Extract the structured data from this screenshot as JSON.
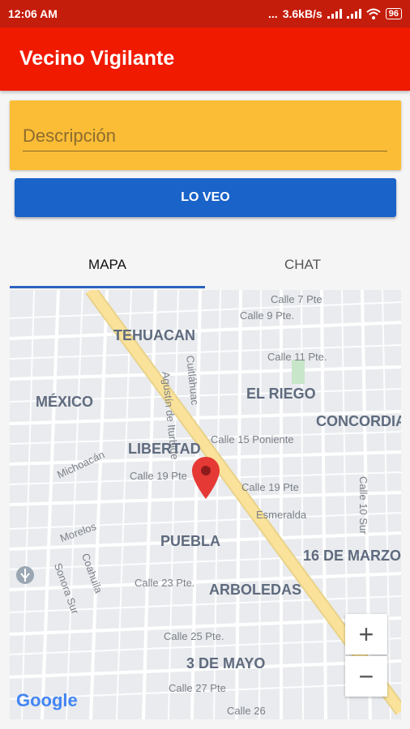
{
  "status_bar": {
    "time": "12:06 AM",
    "dots": "...",
    "speed": "3.6kB/s",
    "battery": "96"
  },
  "app_bar": {
    "title": "Vecino Vigilante"
  },
  "description": {
    "placeholder": "Descripción",
    "value": ""
  },
  "action_button": {
    "label": "LO VEO"
  },
  "tabs": [
    {
      "label": "MAPA",
      "selected": true
    },
    {
      "label": "CHAT",
      "selected": false
    }
  ],
  "map": {
    "neighborhoods": [
      "TEHUACAN",
      "MÉXICO",
      "EL RIEGO",
      "CONCORDIA",
      "LIBERTAD",
      "PUEBLA",
      "16 DE MARZO",
      "ARBOLEDAS",
      "3 DE MAYO"
    ],
    "streets": [
      "Calle 7 Pte",
      "Calle 9 Pte.",
      "Calle 11 Pte.",
      "Agustín de Iturbide",
      "Cuitláhuac",
      "Calle 15 Poniente",
      "Calle 19 Pte",
      "Calle 19 Pte",
      "Esmeralda",
      "Calle 10 Sur",
      "Michoacán",
      "Morelos",
      "Sonora Sur",
      "Coahuila",
      "Calle 23 Pte.",
      "Calle 25 Pte.",
      "Calle 27 Pte",
      "Calle 26"
    ],
    "zoom_in": "+",
    "zoom_out": "−",
    "google_logo": "Google",
    "colors": {
      "highway": "#fbe29a",
      "pin": "#e53935",
      "park": "#c8e6c9",
      "neighborhood_text": "#5f6b7e"
    }
  }
}
